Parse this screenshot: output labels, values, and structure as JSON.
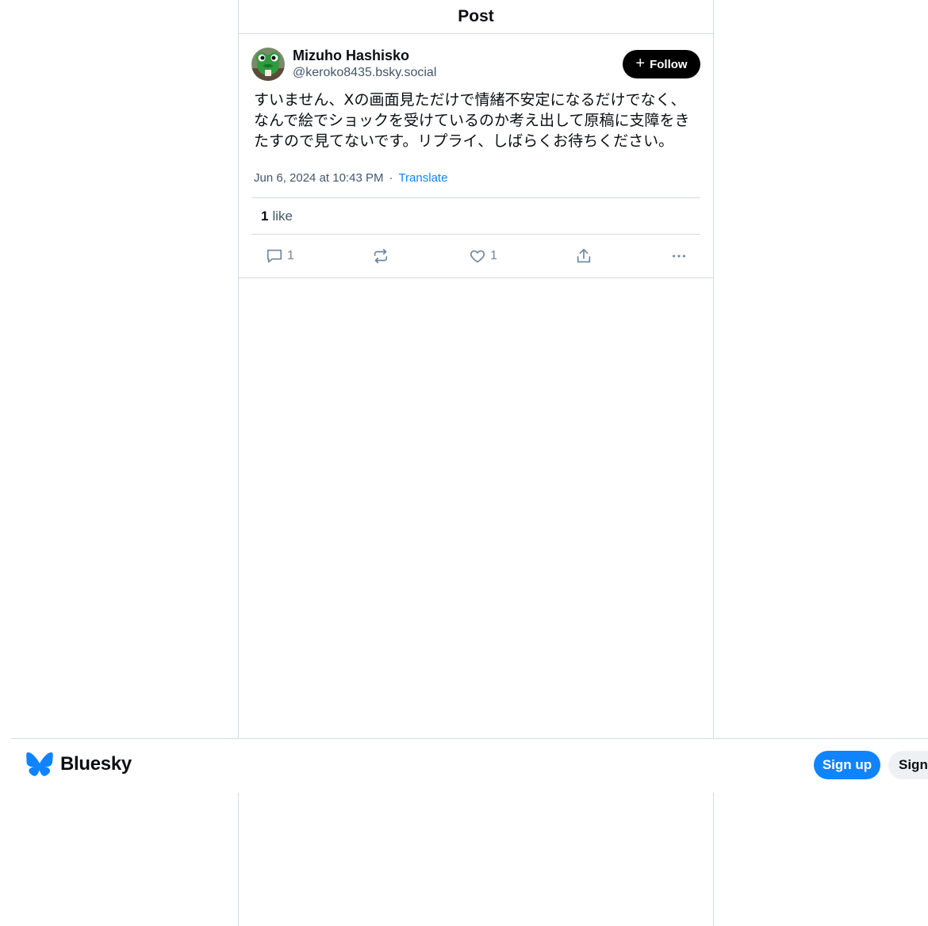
{
  "header": {
    "title": "Post"
  },
  "post": {
    "author_name": "Mizuho Hashisko",
    "author_handle": "@keroko8435.bsky.social",
    "follow_label": "Follow",
    "follow_icon": "plus-icon",
    "text": "すいません、Xの画面見ただけで情緒不安定になるだけでなく、なんで絵でショックを受けているのか考え出して原稿に支障をきたすので見てないです。リプライ、しばらくお待ちください。",
    "timestamp": "Jun 6, 2024 at 10:43 PM",
    "separator": "·",
    "translate_label": "Translate",
    "like_count": "1",
    "like_label": "like",
    "actions": {
      "reply_count": "1",
      "like_count": "1"
    }
  },
  "bottombar": {
    "brand": "Bluesky",
    "signup_label": "Sign up",
    "signin_label": "Sign in"
  },
  "colors": {
    "accent": "#1083fe",
    "border": "#d4dbe2",
    "muted": "#42576c",
    "icon": "#6f869f"
  }
}
